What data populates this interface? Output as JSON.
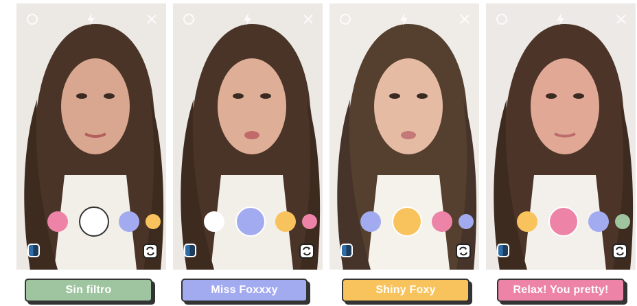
{
  "colors": {
    "green": "#9ec59f",
    "lavender": "#a3abf0",
    "yellow": "#f8c35c",
    "pink": "#ed84a8",
    "white": "#ffffff"
  },
  "panels": [
    {
      "filter_label": "Sin filtro",
      "label_color": "#9ec59f",
      "swatches": [
        {
          "color": "#ed84a8",
          "size": "medium"
        },
        {
          "color": "#ffffff",
          "size": "large",
          "selected": true
        },
        {
          "color": "#a3abf0",
          "size": "medium"
        },
        {
          "color": "#f8c35c",
          "size": "small"
        }
      ]
    },
    {
      "filter_label": "Miss Foxxxy",
      "label_color": "#a3abf0",
      "swatches": [
        {
          "color": "#ffffff",
          "size": "medium"
        },
        {
          "color": "#a3abf0",
          "size": "large",
          "selected": true
        },
        {
          "color": "#f8c35c",
          "size": "medium"
        },
        {
          "color": "#ed84a8",
          "size": "small"
        }
      ]
    },
    {
      "filter_label": "Shiny Foxy",
      "label_color": "#f8c35c",
      "swatches": [
        {
          "color": "#a3abf0",
          "size": "medium"
        },
        {
          "color": "#f8c35c",
          "size": "large",
          "selected": true
        },
        {
          "color": "#ed84a8",
          "size": "medium"
        },
        {
          "color": "#a3abf0",
          "size": "small"
        }
      ]
    },
    {
      "filter_label": "Relax! You pretty!",
      "label_color": "#ed84a8",
      "swatches": [
        {
          "color": "#f8c35c",
          "size": "medium"
        },
        {
          "color": "#ed84a8",
          "size": "large",
          "selected": true
        },
        {
          "color": "#a3abf0",
          "size": "medium"
        },
        {
          "color": "#9ec59f",
          "size": "small"
        }
      ]
    }
  ],
  "icons": {
    "settings": "settings-icon",
    "flash": "flash-icon",
    "close": "close-icon",
    "gallery": "gallery-icon",
    "flip_camera": "flip-camera-icon"
  }
}
